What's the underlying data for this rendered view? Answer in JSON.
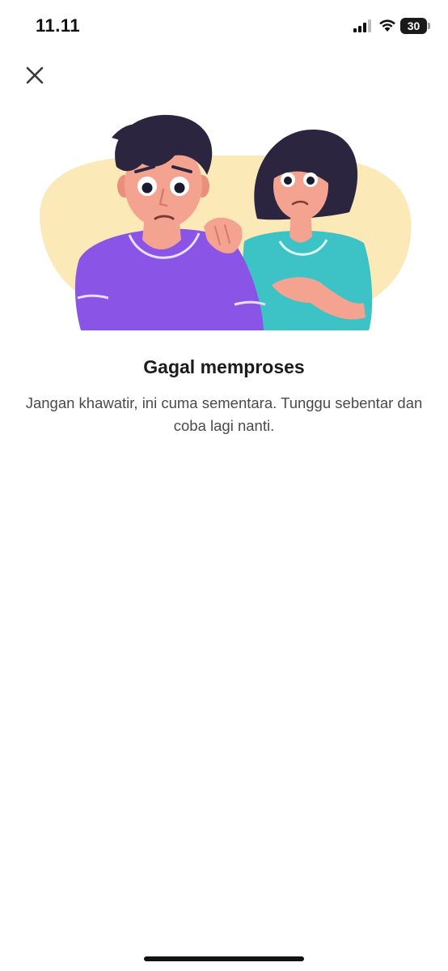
{
  "status_bar": {
    "time": "11.11",
    "battery_level": "30",
    "icons": [
      "signal-icon",
      "wifi-icon",
      "battery-icon"
    ]
  },
  "header": {
    "close_icon": "close-icon"
  },
  "error": {
    "title": "Gagal memproses",
    "message": "Jangan khawatir, ini cuma sementara. Tunggu sebentar dan coba lagi nanti."
  },
  "colors": {
    "illustration_background": "#FCE9B8",
    "shirt_purple": "#8A55E6",
    "shirt_teal": "#3DC3C6",
    "hair": "#2B2540",
    "skin": "#F3A38F"
  }
}
